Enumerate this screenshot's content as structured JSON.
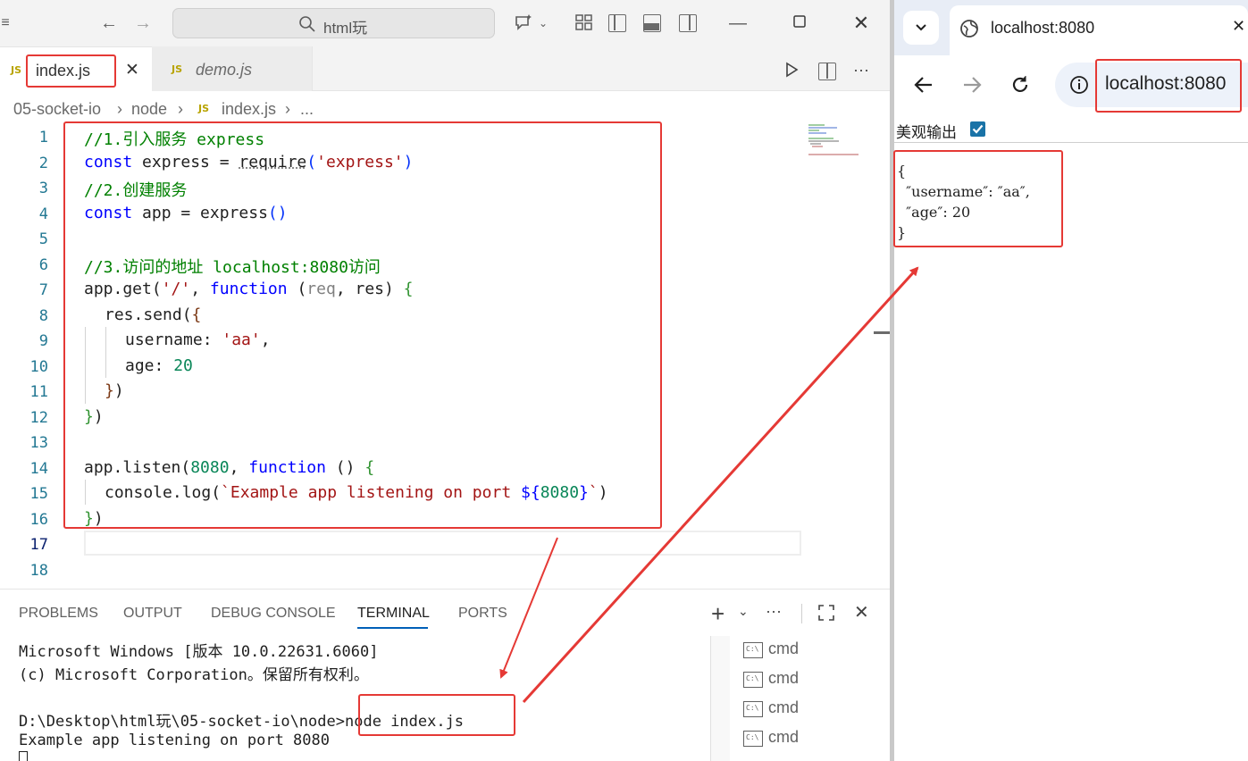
{
  "vscode": {
    "search_text": "html玩",
    "tabs": [
      {
        "badge": "JS",
        "label": "index.js",
        "active": true
      },
      {
        "badge": "JS",
        "label": "demo.js",
        "active": false
      }
    ],
    "breadcrumb": [
      "05-socket-io",
      "node",
      "index.js",
      "..."
    ],
    "breadcrumb_badge": "JS",
    "line_numbers": [
      "1",
      "2",
      "3",
      "4",
      "5",
      "6",
      "7",
      "8",
      "9",
      "10",
      "11",
      "12",
      "13",
      "14",
      "15",
      "16",
      "17",
      "18"
    ],
    "code": {
      "l1": "//1.引入服务 express",
      "l2_kw": "const",
      "l2_a": " express = ",
      "l2_fn": "require",
      "l2_p1": "(",
      "l2_str": "'express'",
      "l2_p2": ")",
      "l3": "//2.创建服务",
      "l4_kw": "const",
      "l4_a": " app = express",
      "l4_p": "()",
      "l6": "//3.访问的地址 localhost:8080访问",
      "l7_a": "app.get(",
      "l7_str": "'/'",
      "l7_b": ", ",
      "l7_kw": "function",
      "l7_c": " (",
      "l7_req": "req",
      "l7_d": ", res) ",
      "l7_brace": "{",
      "l8_a": "res.send(",
      "l8_brace": "{",
      "l9_a": "username: ",
      "l9_str": "'aa'",
      "l9_b": ",",
      "l10_a": "age: ",
      "l10_num": "20",
      "l11_brace": "}",
      "l11_p": ")",
      "l12_brace": "}",
      "l12_p": ")",
      "l14_a": "app.listen(",
      "l14_num": "8080",
      "l14_b": ", ",
      "l14_kw": "function",
      "l14_c": " () ",
      "l14_brace": "{",
      "l15_a": "console.log(",
      "l15_tmpl": "`Example app listening on port ",
      "l15_dollar": "${",
      "l15_num": "8080",
      "l15_close": "}",
      "l15_tick": "`",
      "l15_p": ")",
      "l16_brace": "}",
      "l16_p": ")"
    },
    "panel_tabs": [
      "PROBLEMS",
      "OUTPUT",
      "DEBUG CONSOLE",
      "TERMINAL",
      "PORTS"
    ],
    "terminal_lines": [
      "Microsoft Windows [版本 10.0.22631.6060]",
      "(c) Microsoft Corporation。保留所有权利。",
      "",
      "D:\\Desktop\\html玩\\05-socket-io\\node>node index.js",
      "Example app listening on port 8080"
    ],
    "terminal_list": [
      {
        "icon": "C:\\",
        "label": "cmd"
      },
      {
        "icon": "C:\\",
        "label": "cmd"
      },
      {
        "icon": "C:\\",
        "label": "cmd"
      },
      {
        "icon": "C:\\",
        "label": "cmd"
      }
    ]
  },
  "browser": {
    "tab_title": "localhost:8080",
    "address": "localhost:8080",
    "pretty_print_label": "美观输出",
    "pretty_print_checked": true,
    "json_lines": [
      "{",
      "  ″username″: ″aa″,",
      "  ″age″: 20",
      "}"
    ]
  },
  "colors": {
    "annotation_red": "#e53935",
    "comment": "#008000",
    "keyword": "#0000ff",
    "string": "#a31515",
    "number": "#098658"
  }
}
